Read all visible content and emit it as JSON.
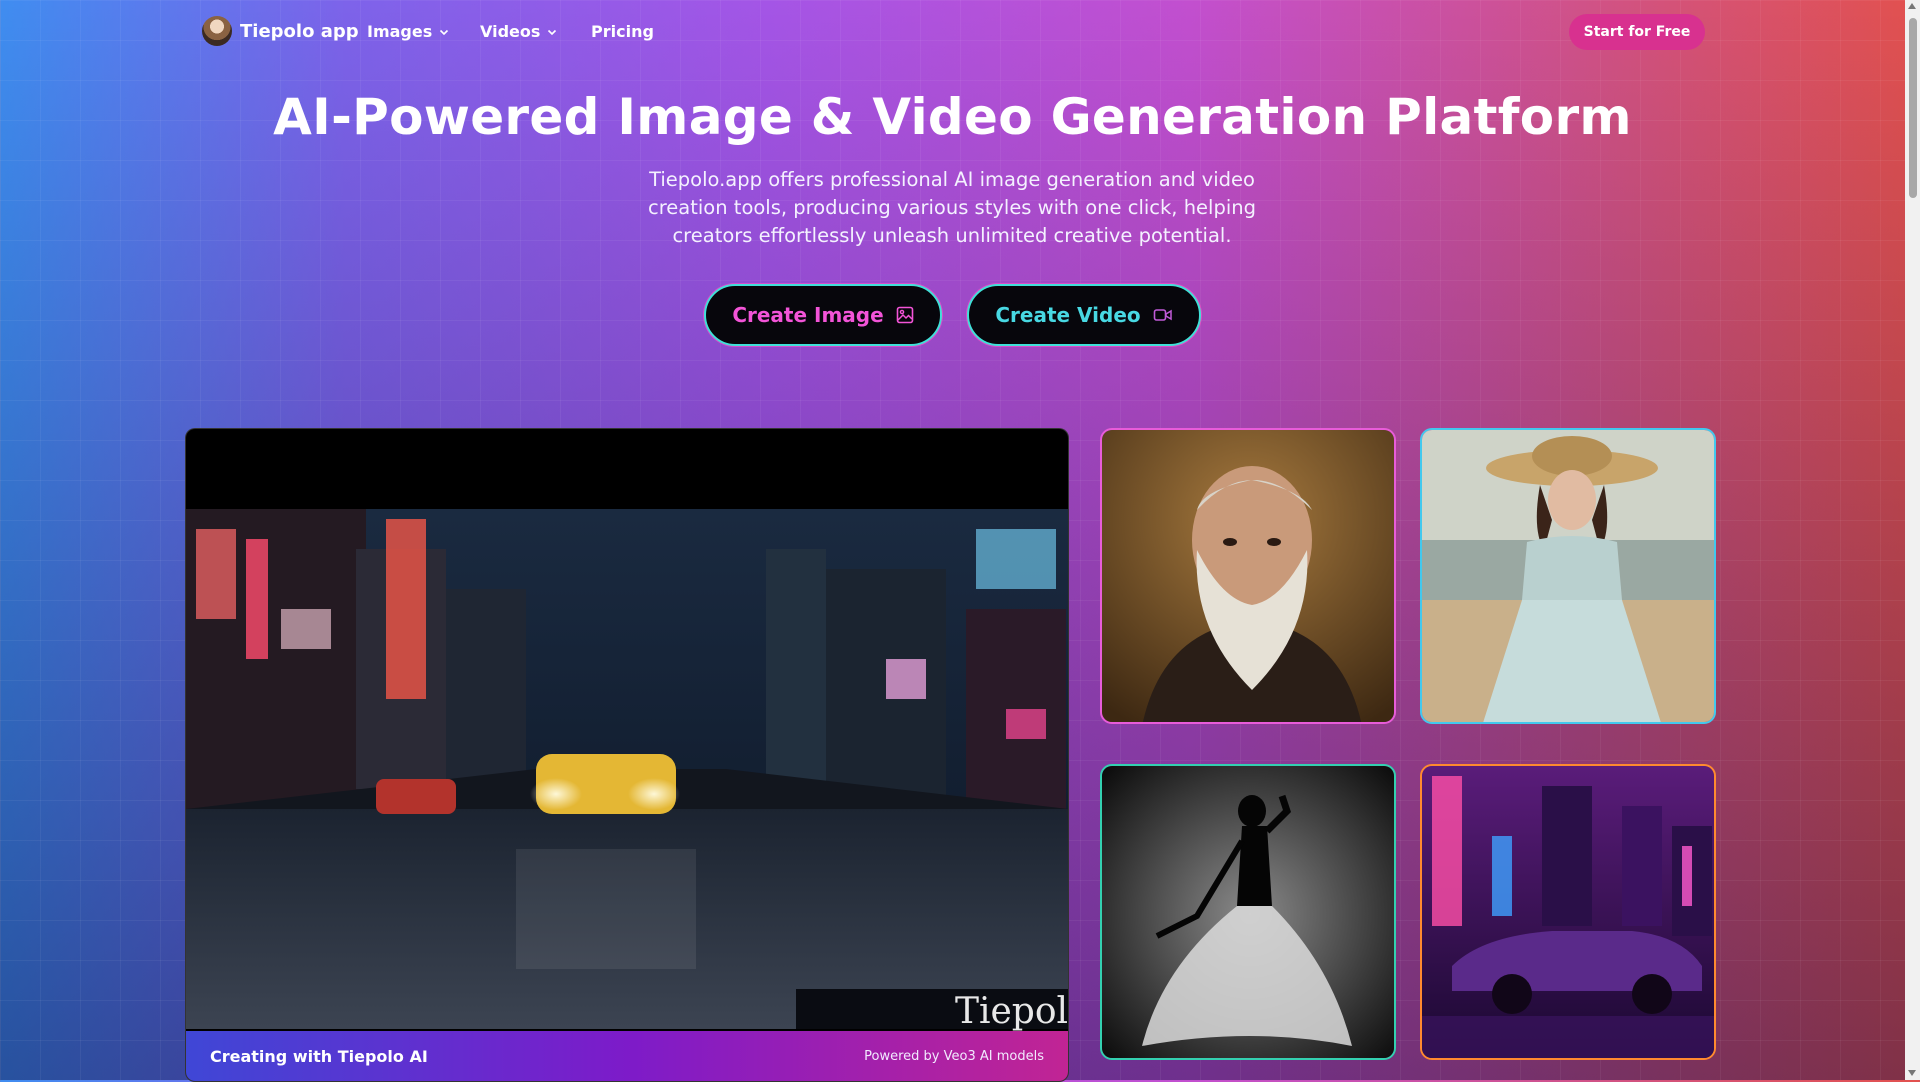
{
  "nav": {
    "brand": "Tiepolo app",
    "items": [
      {
        "label": "Images",
        "has_dropdown": true
      },
      {
        "label": "Videos",
        "has_dropdown": true
      },
      {
        "label": "Pricing",
        "has_dropdown": false
      }
    ],
    "cta_label": "Start for Free"
  },
  "hero": {
    "title": "AI-Powered Image & Video Generation Platform",
    "subtitle": "Tiepolo.app offers professional AI image generation and video creation tools, producing various styles with one click, helping creators effortlessly unleash unlimited creative potential.",
    "buttons": [
      {
        "label": "Create Image",
        "icon": "image-icon"
      },
      {
        "label": "Create Video",
        "icon": "video-camera-icon"
      }
    ]
  },
  "video": {
    "watermark": "Tiepol",
    "caption_left": "Creating with Tiepolo AI",
    "caption_right": "Powered by Veo3 AI models"
  },
  "gallery": [
    {
      "subject": "old-bearded-man-portrait"
    },
    {
      "subject": "woman-in-hat-on-beach"
    },
    {
      "subject": "dancer-silhouette-smoke"
    },
    {
      "subject": "neon-city-muscle-car"
    }
  ],
  "colors": {
    "accent_pink": "#d8318f",
    "cta_image_text": "#f354d8",
    "cta_video_text": "#48d8e3",
    "cta_border": "#40e0d8"
  }
}
